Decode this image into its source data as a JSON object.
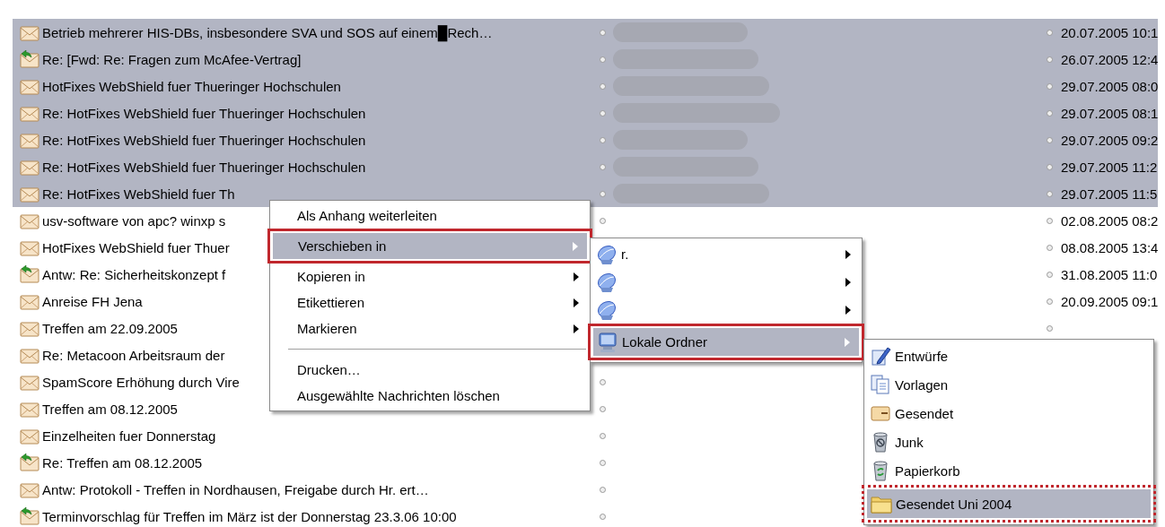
{
  "messages": [
    {
      "subject": "Betrieb mehrerer HIS-DBs, insbesondere SVA und SOS auf einem█Rech…",
      "date": "20.07.2005 10:1",
      "selected": true,
      "kind": "mail"
    },
    {
      "subject": "Re: [Fwd: Re: Fragen zum McAfee-Vertrag]",
      "date": "26.07.2005 12:4",
      "selected": true,
      "kind": "replied"
    },
    {
      "subject": "HotFixes WebShield fuer Thueringer Hochschulen",
      "date": "29.07.2005 08:0",
      "selected": true,
      "kind": "mail"
    },
    {
      "subject": "Re: HotFixes WebShield fuer Thueringer Hochschulen",
      "date": "29.07.2005 08:1",
      "selected": true,
      "kind": "mail"
    },
    {
      "subject": "Re: HotFixes WebShield fuer Thueringer Hochschulen",
      "date": "29.07.2005 09:2",
      "selected": true,
      "kind": "mail"
    },
    {
      "subject": "Re: HotFixes WebShield fuer Thueringer Hochschulen",
      "date": "29.07.2005 11:2",
      "selected": true,
      "kind": "mail"
    },
    {
      "subject": "Re: HotFixes WebShield fuer Th",
      "date": "29.07.2005 11:5",
      "selected": true,
      "kind": "mail"
    },
    {
      "subject": "usv-software von apc? winxp s",
      "date": "02.08.2005 08:2",
      "selected": false,
      "kind": "mail"
    },
    {
      "subject": "HotFixes WebShield fuer Thuer",
      "date": "08.08.2005 13:4",
      "selected": false,
      "kind": "mail"
    },
    {
      "subject": "Antw: Re: Sicherheitskonzept f",
      "date": "31.08.2005 11:0",
      "selected": false,
      "kind": "replied"
    },
    {
      "subject": "Anreise FH Jena",
      "date": "20.09.2005 09:1",
      "selected": false,
      "kind": "mail"
    },
    {
      "subject": "Treffen am 22.09.2005",
      "selected": false,
      "kind": "mail"
    },
    {
      "subject": "Re: Metacoon Arbeitsraum der",
      "selected": false,
      "kind": "mail"
    },
    {
      "subject": "SpamScore Erhöhung durch Vire",
      "selected": false,
      "kind": "mail"
    },
    {
      "subject": "Treffen am 08.12.2005",
      "selected": false,
      "kind": "mail"
    },
    {
      "subject": "Einzelheiten fuer Donnerstag",
      "selected": false,
      "kind": "mail"
    },
    {
      "subject": "Re: Treffen am 08.12.2005",
      "selected": false,
      "kind": "replied"
    },
    {
      "subject": "Antw: Protokoll - Treffen in Nordhausen, Freigabe durch Hr.            ert…",
      "selected": false,
      "kind": "mail"
    },
    {
      "subject": "Terminvorschlag für Treffen im März ist der Donnerstag 23.3.06 10:00",
      "selected": false,
      "kind": "replied"
    }
  ],
  "context_menu": {
    "items": [
      {
        "kind": "item",
        "label": "Als Anhang weiterleiten",
        "submenu": false,
        "selected": false
      },
      {
        "kind": "item",
        "label": "Verschieben in",
        "submenu": true,
        "selected": true
      },
      {
        "kind": "item",
        "label": "Kopieren in",
        "submenu": true,
        "selected": false
      },
      {
        "kind": "item",
        "label": "Etikettieren",
        "submenu": true,
        "selected": false
      },
      {
        "kind": "item",
        "label": "Markieren",
        "submenu": true,
        "selected": false
      },
      {
        "kind": "separator"
      },
      {
        "kind": "item",
        "label": "Drucken…",
        "submenu": false,
        "selected": false
      },
      {
        "kind": "item",
        "label": "Ausgewählte Nachrichten löschen",
        "submenu": false,
        "selected": false
      }
    ]
  },
  "accounts_menu": {
    "items": [
      {
        "kind": "account",
        "label": "r.",
        "submenu": true,
        "selected": false
      },
      {
        "kind": "account",
        "submenu": true,
        "selected": false
      },
      {
        "kind": "account",
        "submenu": true,
        "selected": false
      },
      {
        "kind": "computer",
        "label": "Lokale Ordner",
        "submenu": true,
        "selected": true
      }
    ]
  },
  "folders_menu": {
    "items": [
      {
        "kind": "drafts",
        "label": "Entwürfe",
        "submenu": false,
        "selected": false
      },
      {
        "kind": "templates",
        "label": "Vorlagen",
        "submenu": false,
        "selected": false
      },
      {
        "kind": "sent",
        "label": "Gesendet",
        "submenu": false,
        "selected": false
      },
      {
        "kind": "junk",
        "label": "Junk",
        "submenu": false,
        "selected": false
      },
      {
        "kind": "trash",
        "label": "Papierkorb",
        "submenu": false,
        "selected": false
      },
      {
        "kind": "folder",
        "label": "Gesendet Uni 2004",
        "submenu": false,
        "selected": true
      }
    ]
  }
}
